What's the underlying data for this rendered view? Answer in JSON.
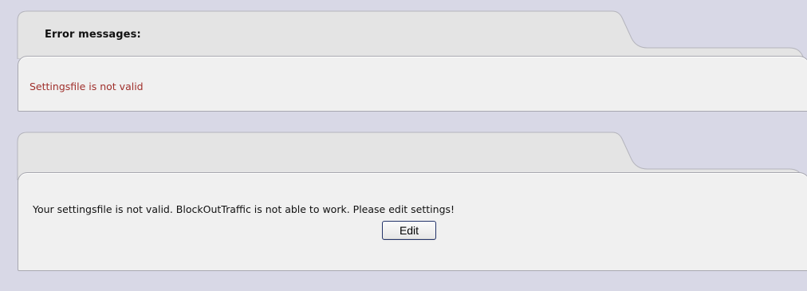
{
  "errors_panel": {
    "title": "Error messages:",
    "message": "Settingsfile is not valid"
  },
  "info_panel": {
    "title": "",
    "message": "Your settingsfile is not valid. BlockOutTraffic is not able to work. Please edit settings!",
    "edit_button_label": "Edit"
  },
  "colors": {
    "page_background": "#d8d8e6",
    "panel_background": "#f0f0f0",
    "tab_background": "#e4e4e4",
    "error_text": "#a0302c",
    "button_border": "#24346a"
  }
}
